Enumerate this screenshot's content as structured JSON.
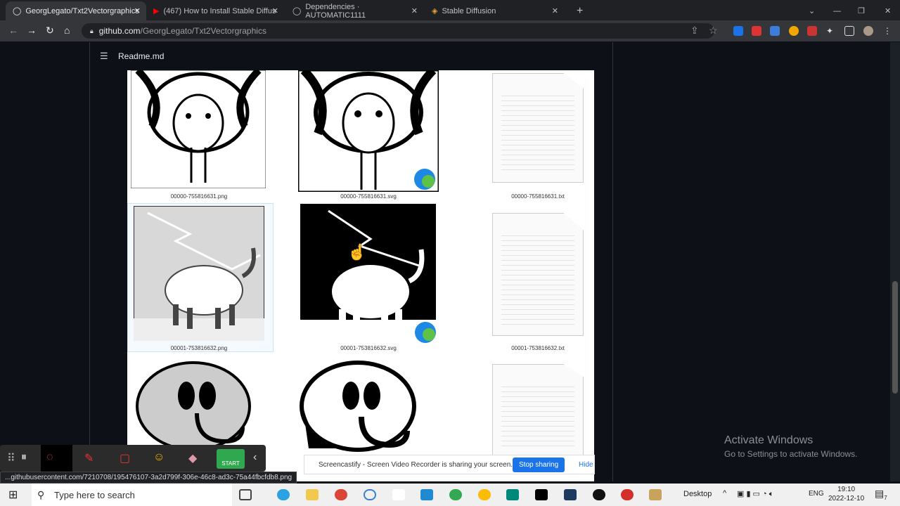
{
  "browser": {
    "tabs": [
      {
        "label": "GeorgLegato/Txt2Vectorgraphics",
        "active": true,
        "icon": "github-icon"
      },
      {
        "label": "(467) How to Install Stable Diffus",
        "icon": "youtube-icon"
      },
      {
        "label": "Dependencies · AUTOMATIC1111",
        "icon": "github-icon"
      },
      {
        "label": "Stable Diffusion",
        "icon": "stable-diffusion-icon"
      }
    ],
    "url_host": "github.com",
    "url_path": "/GeorgLegato/Txt2Vectorgraphics"
  },
  "readme": {
    "title": "Readme.md"
  },
  "files": [
    {
      "png": "00000-755816631.png",
      "svg": "00000-755816631.svg",
      "txt": "00000-755816631.txt"
    },
    {
      "png": "00001-753816632.png",
      "svg": "00001-753816632.svg",
      "txt": "00001-753816632.txt"
    }
  ],
  "status_url": "...githubusercontent.com/7210708/195476107-3a2d799f-306e-46c8-ad3c-75a44fbcfdb8.png",
  "recorder": {
    "start_label": "START"
  },
  "share_bar": {
    "message": "Screencastify - Screen Video Recorder is sharing your screen.",
    "stop": "Stop sharing",
    "hide": "Hide"
  },
  "watermark": {
    "title": "Activate Windows",
    "subtitle": "Go to Settings to activate Windows."
  },
  "taskbar": {
    "search_placeholder": "Type here to search",
    "desktop": "Desktop",
    "lang": "ENG",
    "time": "19:10",
    "date": "2022-12-10",
    "notifications": "7"
  }
}
